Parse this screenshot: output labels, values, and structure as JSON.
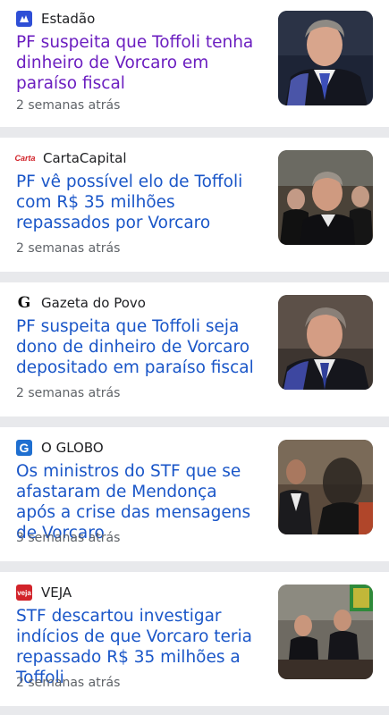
{
  "articles": [
    {
      "source": "Estadão",
      "logo_text": "",
      "logo_color": "#2f4fd6",
      "headline": "PF suspeita que Toffoli tenha dinheiro de Vorcaro em paraíso fiscal",
      "time": "2 semanas atrás",
      "headline_color": "#6b1ec0"
    },
    {
      "source": "CartaCapital",
      "logo_text": "Carta",
      "logo_color": "#d2232a",
      "headline": "PF vê possível elo de Toffoli com R$ 35 milhões repassados por Vorcaro",
      "time": "2 semanas atrás",
      "headline_color": "#1a56c8"
    },
    {
      "source": "Gazeta do Povo",
      "logo_text": "G",
      "logo_color": "#111111",
      "headline": "PF suspeita que Toffoli seja dono de dinheiro de Vorcaro depositado em paraíso fiscal",
      "time": "2 semanas atrás",
      "headline_color": "#1a56c8"
    },
    {
      "source": "O GLOBO",
      "logo_text": "G",
      "logo_color": "#1f6fd0",
      "headline": "Os ministros do STF que se afastaram de Mendonça após a crise das mensagens de Vorcaro",
      "time": "3 semanas atrás",
      "headline_color": "#1a56c8"
    },
    {
      "source": "VEJA",
      "logo_text": "veja",
      "logo_color": "#d2232a",
      "headline": "STF descartou investigar indícios de que Vorcaro teria repassado R$ 35 milhões a Toffoli",
      "time": "2 semanas atrás",
      "headline_color": "#1a56c8"
    }
  ]
}
